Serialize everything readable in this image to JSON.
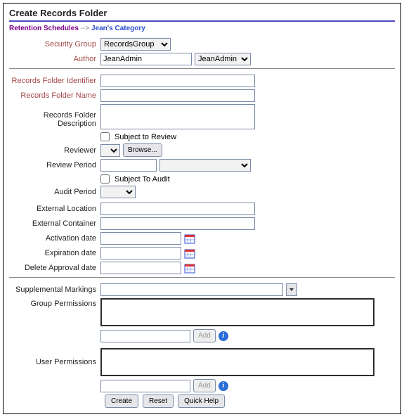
{
  "title": "Create Records Folder",
  "breadcrumb": {
    "root": "Retention Schedules",
    "sep": "-->",
    "current": "Jean's Category"
  },
  "labels": {
    "security_group": "Security Group",
    "author": "Author",
    "folder_identifier": "Records Folder Identifier",
    "folder_name": "Records Folder Name",
    "folder_desc": "Records Folder Description",
    "subject_review": "Subject to Review",
    "reviewer": "Reviewer",
    "review_period": "Review Period",
    "subject_audit": "Subject To Audit",
    "audit_period": "Audit Period",
    "external_location": "External Location",
    "external_container": "External Container",
    "activation_date": "Activation date",
    "expiration_date": "Expiration date",
    "delete_approval_date": "Delete Approval date",
    "supplemental_markings": "Supplemental Markings",
    "group_permissions": "Group Permissions",
    "user_permissions": "User Permissions"
  },
  "values": {
    "security_group_selected": "RecordsGroup",
    "author_text": "JeanAdmin",
    "author_select": "JeanAdmin",
    "folder_identifier": "",
    "folder_name": "",
    "folder_desc": "",
    "subject_review": false,
    "reviewer_select": "",
    "review_period_text": "",
    "review_period_select": "",
    "subject_audit": false,
    "audit_period_select": "",
    "external_location": "",
    "external_container": "",
    "activation_date": "",
    "expiration_date": "",
    "delete_approval_date": "",
    "supplemental_markings": "",
    "group_perm_new": "",
    "user_perm_new": ""
  },
  "buttons": {
    "browse": "Browse...",
    "add": "Add",
    "create": "Create",
    "reset": "Reset",
    "quick_help": "Quick Help"
  },
  "icons": {
    "calendar": "calendar-icon",
    "info": "i",
    "chevron_down": "chevron-down-icon"
  }
}
